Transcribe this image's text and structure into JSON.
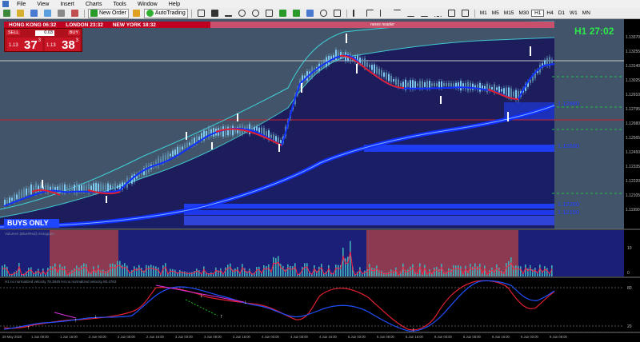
{
  "menu": [
    "File",
    "View",
    "Insert",
    "Charts",
    "Tools",
    "Window",
    "Help"
  ],
  "toolbar": {
    "new_order": "New Order",
    "autotrading": "AutoTrading",
    "timeframes": [
      "M1",
      "M5",
      "M15",
      "M30",
      "H1",
      "H4",
      "D1",
      "W1",
      "MN"
    ],
    "active_timeframe": "H1"
  },
  "clocks": [
    "HONG KONG 06:32",
    "LONDON 23:32",
    "NEW YORK 18:32"
  ],
  "news_reader": "news reader",
  "trade_panel": {
    "sell_label": "SELL",
    "buy_label": "BUY",
    "lot": "0.03",
    "sell_price_small": "1.13",
    "sell_price_big": "37",
    "sell_price_sup": "3",
    "buy_price_small": "1.13",
    "buy_price_big": "38",
    "buy_price_sup": "3"
  },
  "buys_only": "BUYS ONLY",
  "candle_timer": {
    "label": "H1",
    "value": "27:02"
  },
  "price_axis": [
    "1.13370",
    "1.13255",
    "1.13140",
    "1.13025",
    "1.12910",
    "1.12795",
    "1.12680",
    "1.12565",
    "1.12450",
    "1.12335",
    "1.12220",
    "1.12105",
    "1.11990"
  ],
  "blue_labels": [
    "1.12860",
    "1.12690",
    "1.12260",
    "1.12150"
  ],
  "sub_window1": {
    "title": "Volumes (Blue/Red) Histogram",
    "scale": [
      "10",
      "0"
    ]
  },
  "sub_window2": {
    "title": "H1 no normalized velocity 78.3849  H4 no normalized velocity 80.4763",
    "scale": [
      "80",
      "20"
    ]
  },
  "time_axis": [
    "29 May 2020",
    "1 Jun 08:00",
    "1 Jun 16:00",
    "2 Jun 00:00",
    "2 Jun 08:00",
    "2 Jun 16:00",
    "3 Jun 00:00",
    "3 Jun 08:00",
    "3 Jun 16:00",
    "4 Jun 00:00",
    "4 Jun 08:00",
    "4 Jun 16:00",
    "5 Jun 00:00",
    "5 Jun 08:00",
    "5 Jun 16:00",
    "8 Jun 00:00",
    "8 Jun 08:00",
    "8 Jun 16:00",
    "9 Jun 00:00",
    "9 Jun 08:00"
  ],
  "colors": {
    "accent": "#c00020",
    "ma_blue": "#1030ff",
    "ma_red": "#e02030",
    "bg_band": "#1c1d5a",
    "timer": "#2ee84a"
  }
}
